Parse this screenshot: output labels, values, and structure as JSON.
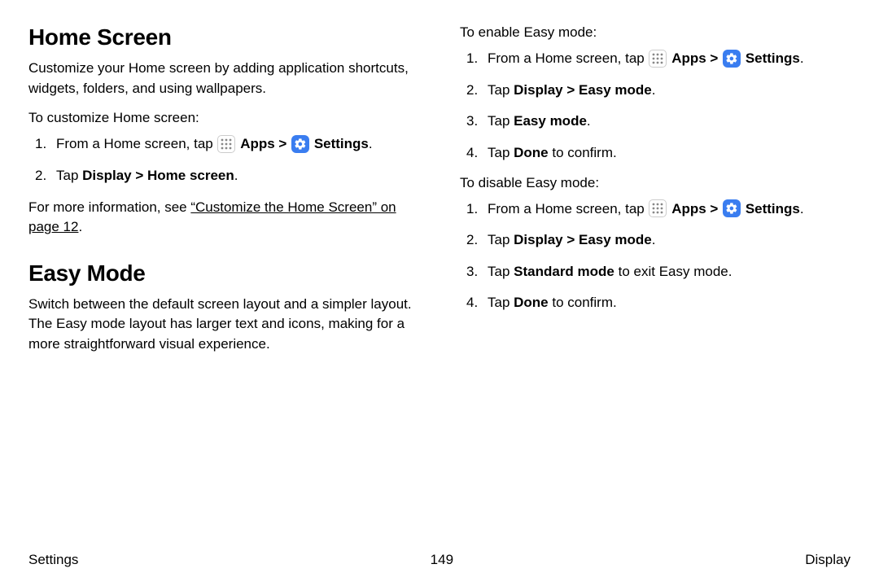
{
  "left": {
    "h1a": "Home Screen",
    "p1": "Customize your Home screen by adding application shortcuts, widgets, folders, and using wallpapers.",
    "lead1": "To customize Home screen:",
    "l1_step1_pre": "From a Home screen, tap ",
    "apps_label": "Apps",
    "sep": " > ",
    "settings_label": "Settings",
    "period": ".",
    "l1_step2_pre": "Tap ",
    "l1_step2_bold": "Display > Home screen",
    "more_pre": "For more information, see ",
    "more_link": "“Customize the Home Screen” on page 12",
    "h1b": "Easy Mode",
    "p2": "Switch between the default screen layout and a simpler layout. The Easy mode layout has larger text and icons, making for a more straightforward visual experience."
  },
  "right": {
    "lead1": "To enable Easy mode:",
    "en_step1_pre": "From a Home screen, tap ",
    "en_step2_pre": "Tap ",
    "en_step2_bold": "Display > Easy mode",
    "en_step3_pre": "Tap ",
    "en_step3_bold": "Easy mode",
    "en_step4_pre": "Tap ",
    "en_step4_bold": "Done",
    "en_step4_post": " to confirm.",
    "lead2": "To disable Easy mode:",
    "di_step1_pre": "From a Home screen, tap ",
    "di_step2_pre": "Tap ",
    "di_step2_bold": "Display > Easy mode",
    "di_step3_pre": "Tap ",
    "di_step3_bold": "Standard mode",
    "di_step3_post": " to exit Easy mode.",
    "di_step4_pre": "Tap ",
    "di_step4_bold": "Done",
    "di_step4_post": " to confirm."
  },
  "footer": {
    "left": "Settings",
    "center": "149",
    "right": "Display"
  }
}
